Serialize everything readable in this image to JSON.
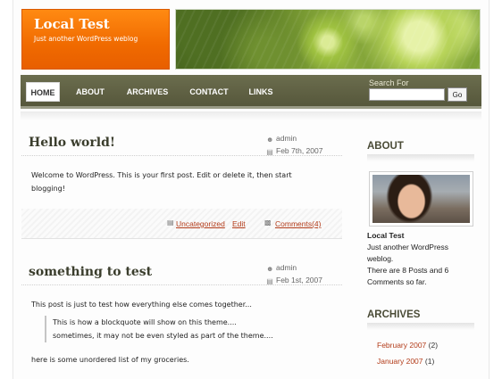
{
  "header": {
    "site_title": "Local Test",
    "tagline": "Just another WordPress weblog"
  },
  "nav": {
    "items": [
      {
        "label": "HOME",
        "active": true
      },
      {
        "label": "ABOUT",
        "active": false
      },
      {
        "label": "ARCHIVES",
        "active": false
      },
      {
        "label": "CONTACT",
        "active": false
      },
      {
        "label": "LINKS",
        "active": false
      }
    ],
    "search_label": "Search For",
    "search_value": "",
    "search_button": "Go"
  },
  "posts": [
    {
      "title": "Hello world!",
      "author": "admin",
      "date": "Feb 7th, 2007",
      "body_lines": [
        "Welcome to WordPress. This is your first post. Edit or delete it, then start",
        "blogging!"
      ],
      "category": "Uncategorized",
      "edit_label": "Edit",
      "comments": "Comments(4)"
    },
    {
      "title": "something to test",
      "author": "admin",
      "date": "Feb 1st, 2007",
      "intro": "This post is just to test how everything else comes together...",
      "blockquote_lines": [
        "This is how a blockquote will show on this theme....",
        "sometimes, it may not be even styled as part of the theme...."
      ],
      "after": "here is some unordered list of my groceries."
    }
  ],
  "sidebar": {
    "about_title": "ABOUT",
    "name": "Local Test",
    "desc_lines": [
      "Just another WordPress",
      "weblog."
    ],
    "stats_lines": [
      "There are 8 Posts and 6",
      "Comments so far."
    ],
    "archives_title": "ARCHIVES",
    "archives": [
      {
        "label": "February 2007",
        "count": "(2)"
      },
      {
        "label": "January 2007",
        "count": "(1)"
      }
    ]
  },
  "colors": {
    "brand_orange": "#f06a00",
    "nav_olive": "#5f6044",
    "link_red": "#b33c1a"
  }
}
